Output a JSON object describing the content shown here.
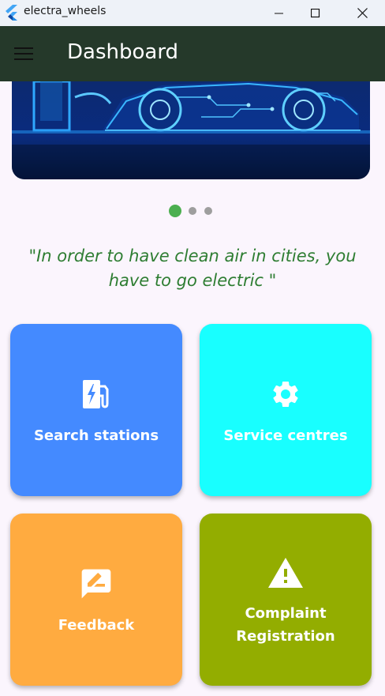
{
  "window": {
    "title": "electra_wheels",
    "titlebar_color": "#eef2f8"
  },
  "appbar": {
    "title": "Dashboard",
    "background": "#25392a",
    "menu_icon": "menu-icon"
  },
  "carousel": {
    "image": "electric-car-circuit-banner",
    "page_count": 3,
    "active_index": 0
  },
  "quote": {
    "text": "\"In order to have clean air in cities, you have to go electric \""
  },
  "tiles": [
    {
      "label": "Search stations",
      "icon": "ev-station-icon",
      "color": "#448aff"
    },
    {
      "label": "Service centres",
      "icon": "gear-icon",
      "color": "#18ffff"
    },
    {
      "label": "Feedback",
      "icon": "feedback-icon",
      "color": "#ffab40"
    },
    {
      "label": "Complaint Registration",
      "icon": "warning-icon",
      "color": "#93ad00"
    }
  ]
}
